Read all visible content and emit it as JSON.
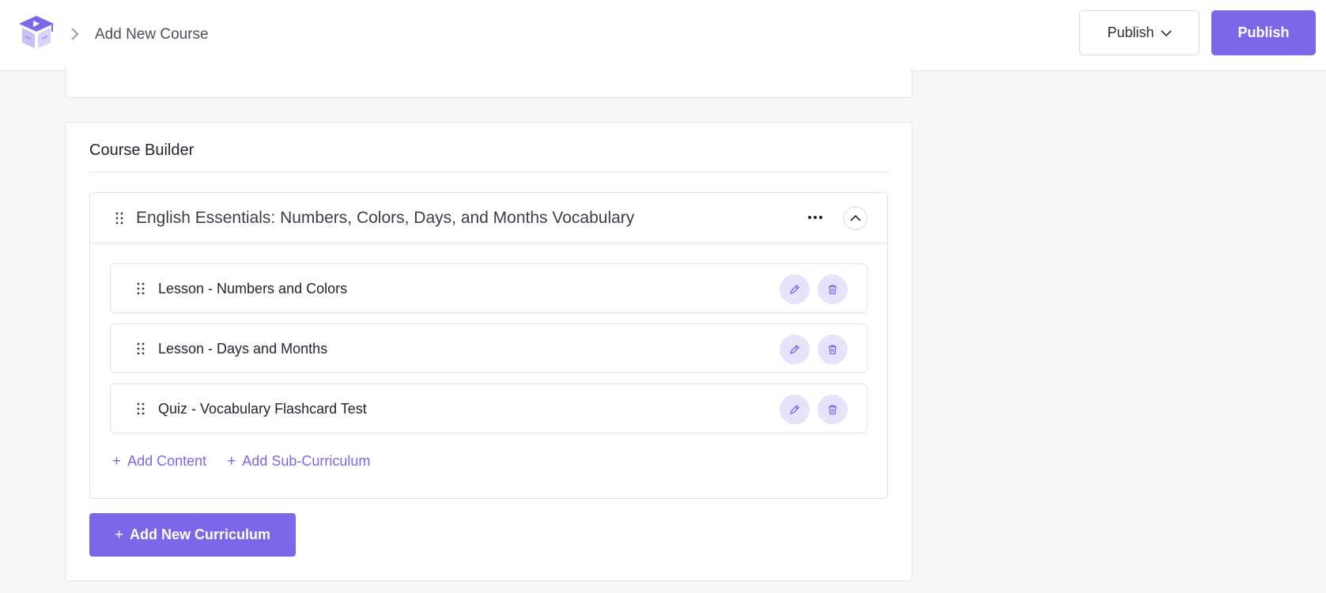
{
  "header": {
    "breadcrumb": "Add New Course",
    "publish_dropdown_label": "Publish",
    "publish_button_label": "Publish"
  },
  "builder": {
    "title": "Course Builder",
    "section": {
      "title": "English Essentials: Numbers, Colors, Days, and Months Vocabulary",
      "items": [
        {
          "title": "Lesson - Numbers and Colors"
        },
        {
          "title": "Lesson - Days and Months"
        },
        {
          "title": "Quiz - Vocabulary Flashcard Test"
        }
      ],
      "add_content_label": "Add Content",
      "add_sub_curriculum_label": "Add Sub-Curriculum"
    },
    "add_curriculum_label": "Add New Curriculum"
  },
  "colors": {
    "accent": "#7a68e9",
    "accent_light": "#e7e3fb"
  },
  "icons": [
    "logo-icon",
    "chevron-right-icon",
    "chevron-down-icon",
    "drag-handle-icon",
    "more-horizontal-icon",
    "chevron-up-icon",
    "pencil-icon",
    "trash-icon",
    "plus-icon"
  ]
}
